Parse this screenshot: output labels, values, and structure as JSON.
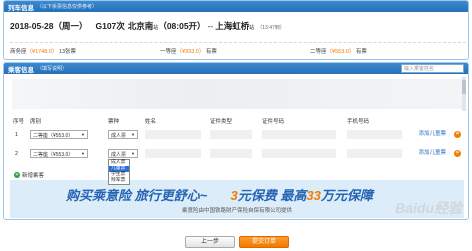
{
  "train": {
    "header_title": "列车信息",
    "header_sub": "（以下余票信息仅供参考）",
    "date": "2018-05-28（周一）",
    "train_no": "G107次",
    "from_station": "北京南",
    "from_tag": "站",
    "depart_time": "（08:05开）",
    "arrow": "--",
    "to_station": "上海虹桥",
    "to_tag": "站",
    "duration": "（13:47到）",
    "seats": [
      {
        "name": "商务座",
        "price": "（¥1748.0）",
        "avail": "13张票"
      },
      {
        "name": "一等座",
        "price": "（¥933.0）",
        "avail": "有票"
      },
      {
        "name": "二等座",
        "price": "（¥553.0）",
        "avail": "有票"
      }
    ]
  },
  "passenger": {
    "header_title": "乘客信息",
    "header_sub": "（填写说明）",
    "search_placeholder": "输入乘客姓名",
    "columns": {
      "index": "序号",
      "seat": "席别",
      "ticket": "票种",
      "name": "姓名",
      "id_type": "证件类型",
      "id_no": "证件号码",
      "phone": "手机号码"
    },
    "rows": [
      {
        "num": "1",
        "seat": "二等座（¥553.0）",
        "ticket": "成人票",
        "add_child": "添加儿童票"
      },
      {
        "num": "2",
        "seat": "二等座（¥553.0）",
        "ticket": "成人票",
        "add_child": "添加儿童票"
      }
    ],
    "ticket_options": [
      "成人票",
      "儿童票",
      "学生票",
      "残军票"
    ],
    "selected_option": "儿童票",
    "add_passenger": "新增乘客"
  },
  "banner": {
    "part1": "购买乘意险",
    "part2": "旅行更舒心~",
    "part3_num": "3",
    "part3_text": "元保费",
    "part4_text1": "最高",
    "part4_num": "33",
    "part4_text2": "万元保障",
    "sub": "乘意险由中国铁路财产保险自保有限公司提供"
  },
  "watermark": "Baidu经验",
  "buttons": {
    "prev": "上一步",
    "submit": "提交订单"
  },
  "colors": {
    "header_blue": "#2570b8",
    "price_orange": "#f07c00",
    "submit_orange": "#f27a00",
    "link_blue": "#2a6fc4"
  }
}
